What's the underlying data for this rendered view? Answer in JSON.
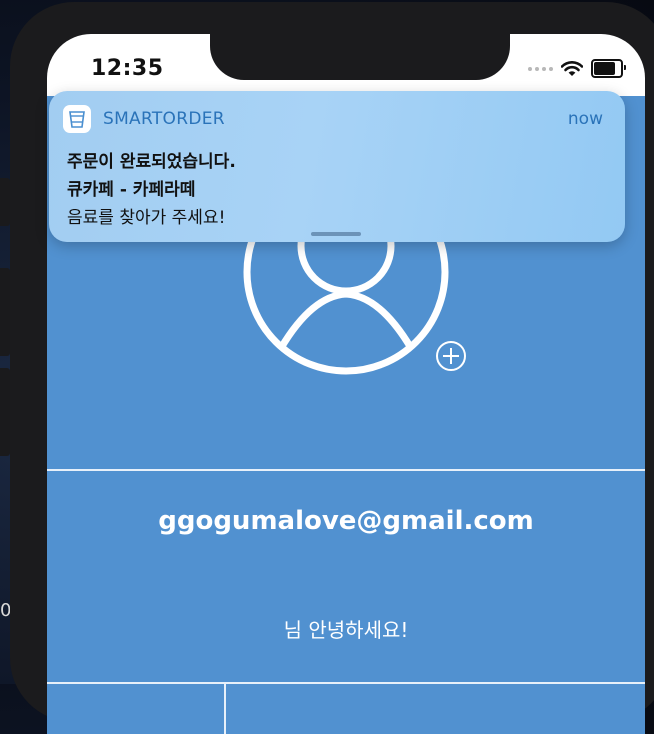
{
  "status_bar": {
    "time": "12:35"
  },
  "notification": {
    "app_name": "SMARTORDER",
    "time": "now",
    "title": "주문이 완료되었습니다.",
    "subtitle": "큐카페 - 카페라떼",
    "body": "음료를 찾아가 주세요!"
  },
  "profile": {
    "email": "ggogumalove@gmail.com",
    "greeting": "님 안녕하세요!"
  },
  "background": {
    "edge_text": "0"
  },
  "colors": {
    "app_background": "#5191d0",
    "notification_background": "#a2cdf1",
    "notification_accent": "#2a73b9"
  }
}
